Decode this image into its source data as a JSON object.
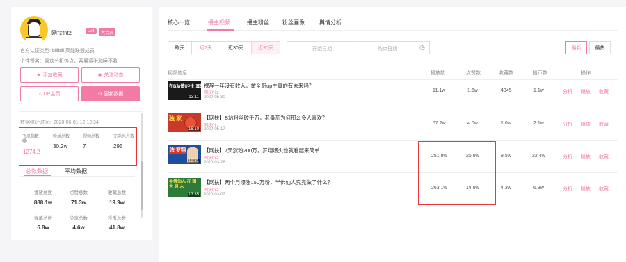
{
  "profile": {
    "name": "网扶fritz",
    "level": "Lv6",
    "vip": "大会员",
    "auth": "官方认证类型: bilibili 高能联盟成员",
    "signature": "个性签名：喜欢分析热点，容易紧张和睡不着"
  },
  "actions": {
    "favorite": "添加收藏",
    "follow": "关注动态",
    "homepage": "UP主页",
    "update": "更新数据"
  },
  "stats": {
    "time_label": "数据统计时间:",
    "time_value": "2020-06-01 12:12:34",
    "items": [
      {
        "label": "飞瓜指数",
        "value": "1274.2"
      },
      {
        "label": "粉丝总数",
        "value": "30.2w"
      },
      {
        "label": "视频总数",
        "value": "7"
      },
      {
        "label": "充电总人数",
        "value": "295"
      }
    ],
    "tabs": [
      "总数数据",
      "平均数据"
    ],
    "grid": [
      {
        "label": "播放总数",
        "value": "888.1w"
      },
      {
        "label": "点赞总数",
        "value": "71.3w"
      },
      {
        "label": "收藏总数",
        "value": "19.9w"
      },
      {
        "label": "弹幕总数",
        "value": "6.8w"
      },
      {
        "label": "分享总数",
        "value": "4.6w"
      },
      {
        "label": "投币总数",
        "value": "41.8w"
      }
    ]
  },
  "main": {
    "tabs": [
      "核心一览",
      "播主视频",
      "播主粉丝",
      "粉丝画像",
      "舆情分析"
    ],
    "ranges": [
      "昨天",
      "近7天",
      "近30天",
      "近90天"
    ],
    "date_start": "开始日期",
    "date_sep": "-",
    "date_end": "结束日期",
    "sort": [
      "最新",
      "最热"
    ],
    "headers": [
      "视频信息",
      "播放数",
      "点赞数",
      "收藏数",
      "投币数",
      "操作"
    ],
    "videos": [
      {
        "title": "裸辞一年没有收入，做全职up主真的有未来吗？",
        "author": "网扶fritz",
        "date": "2020-05-30",
        "duration": "13:11",
        "cap": "在B站做UP主 真的会有未来吗",
        "plays": "11.1w",
        "likes": "1.6w",
        "favs": "4345",
        "coins": "1.1w"
      },
      {
        "title": "【网扶】B站粉丝破千万，老番茄为何那么多人喜欢？",
        "author": "网扶fritz",
        "date": "2020-05-17",
        "duration": "16:10",
        "cap": "独 家",
        "plays": "57.2w",
        "likes": "4.0w",
        "favs": "1.0w",
        "coins": "2.1w"
      },
      {
        "title": "【网扶】7天涨粉200万，罗翔爆火也就看起来简单",
        "author": "网扶fritz",
        "date": "2020-03-26",
        "duration": "19:31",
        "cap": "法 罗翔",
        "plays": "251.8w",
        "likes": "26.9w",
        "favs": "8.5w",
        "coins": "22.4w"
      },
      {
        "title": "【网扶】两个月爆涨150万粉，半佛仙人究竟做了什么？",
        "author": "网扶fritz",
        "date": "2020-03-07",
        "duration": "13:35",
        "cap": "半佛仙人 在 国 大 另 人",
        "plays": "263.1w",
        "likes": "14.9w",
        "favs": "4.3w",
        "coins": "6.3w"
      }
    ],
    "row_actions": [
      "分析",
      "播放",
      "收藏"
    ]
  },
  "colors": {
    "accent": "#f27aa3",
    "highlight": "#e8383d"
  }
}
